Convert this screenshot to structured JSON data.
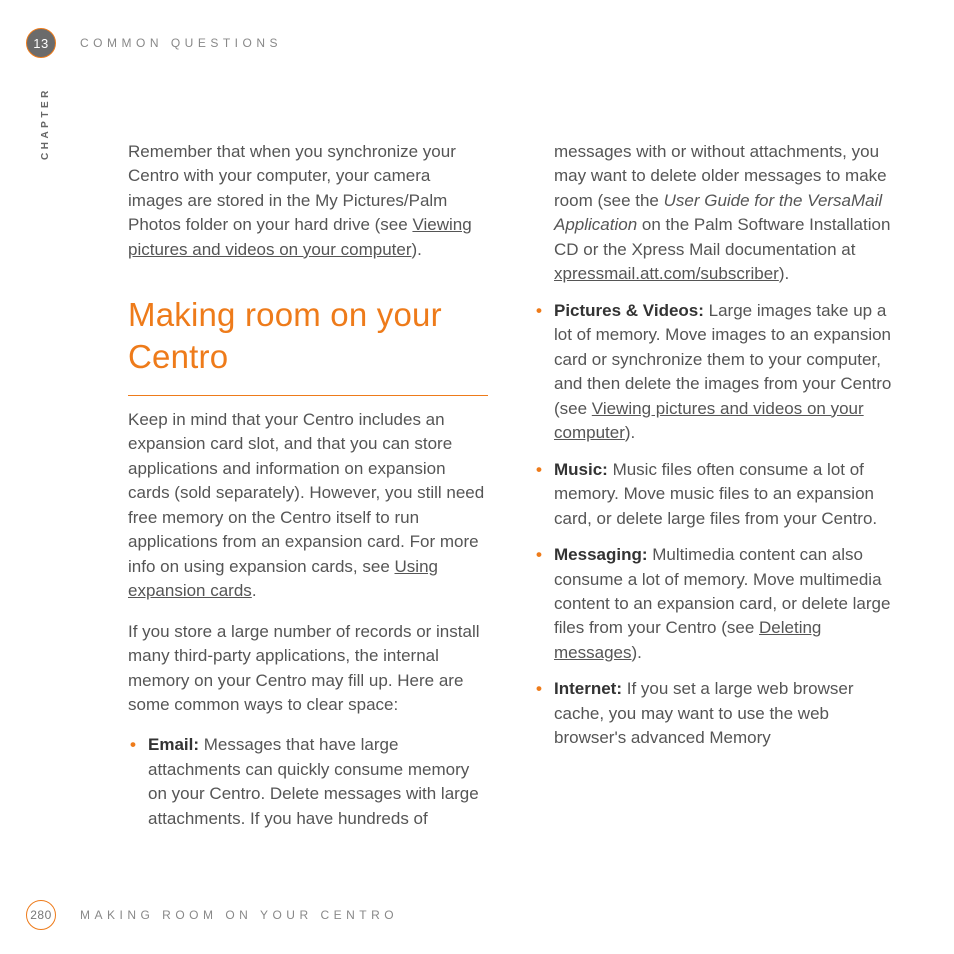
{
  "chapter": {
    "number": "13",
    "label": "CHAPTER"
  },
  "header": {
    "section": "COMMON QUESTIONS"
  },
  "intro": {
    "text_before_link": "Remember that when you synchronize your Centro with your computer, your camera images are stored in the My Pictures/Palm Photos folder on your hard drive (see ",
    "link": "Viewing pictures and videos on your computer",
    "text_after_link": ")."
  },
  "section_title": "Making room on your Centro",
  "para1": {
    "before": "Keep in mind that your Centro includes an expansion card slot, and that you can store applications and information on expansion cards (sold separately). However, you still need free memory on the Centro itself to run applications from an expansion card. For more info on using expansion cards, see ",
    "link": "Using expansion cards",
    "after": "."
  },
  "para2": "If you store a large number of records or install many third-party applications, the internal memory on your Centro may fill up. Here are some common ways to clear space:",
  "bullets": {
    "email": {
      "label": "Email:",
      "t1": " Messages that have large attachments can quickly consume memory on your Centro. Delete messages with large attachments. If you have hundreds of messages with or without attachments, you may want to delete older messages to make room (see the ",
      "italic": "User Guide for the VersaMail Application",
      "t2": " on the Palm Software Installation CD or the Xpress Mail documentation at ",
      "link": "xpressmail.att.com/subscriber",
      "t3": ")."
    },
    "pictures": {
      "label": "Pictures & Videos:",
      "t1": " Large images take up a lot of memory. Move images to an expansion card or synchronize them to your computer, and then delete the images from your Centro (see ",
      "link": "Viewing pictures and videos on your computer",
      "t2": ")."
    },
    "music": {
      "label": "Music:",
      "text": " Music files often consume a lot of memory. Move music files to an expansion card, or delete large files from your Centro."
    },
    "messaging": {
      "label": "Messaging:",
      "t1": " Multimedia content can also consume a lot of memory. Move multimedia content to an expansion card, or delete large files from your Centro (see ",
      "link": "Deleting messages",
      "t2": ")."
    },
    "internet": {
      "label": "Internet:",
      "text": " If you set a large web browser cache, you may want to use the web browser's advanced Memory"
    }
  },
  "footer": {
    "page_number": "280",
    "section": "MAKING ROOM ON YOUR CENTRO"
  }
}
